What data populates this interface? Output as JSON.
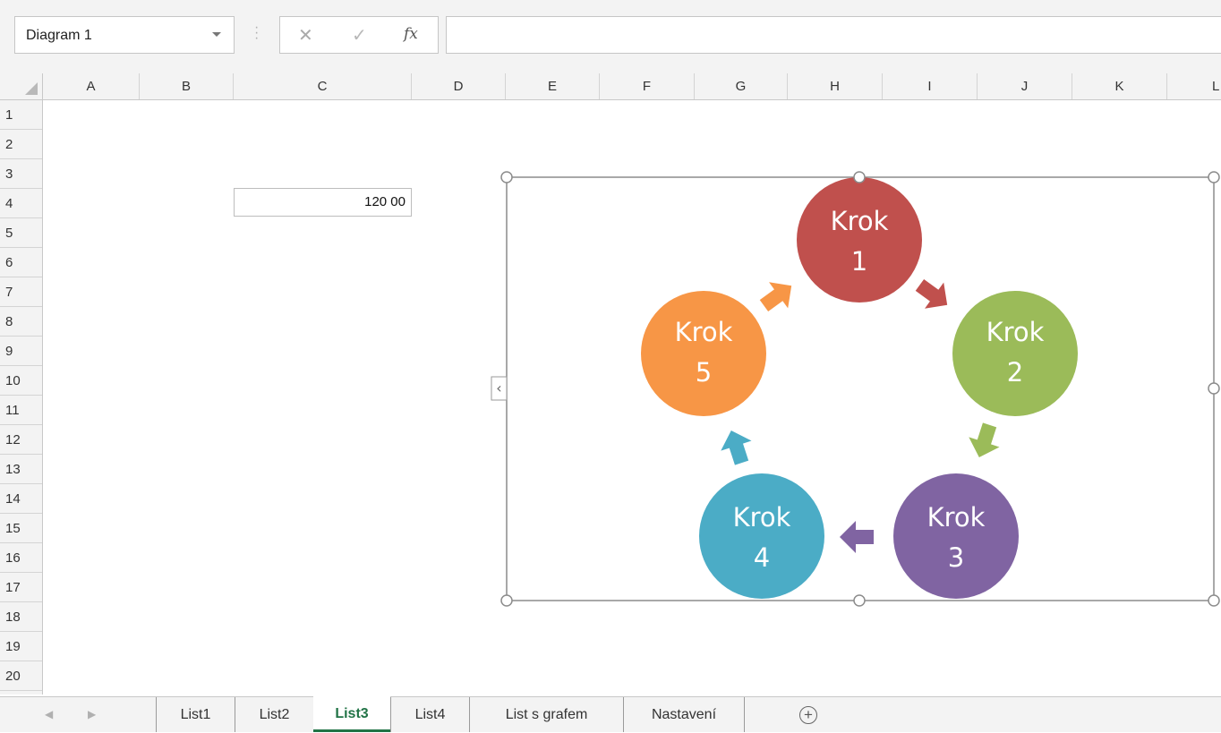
{
  "formula_bar": {
    "name_box": "Diagram 1",
    "cancel_icon": "✕",
    "enter_icon": "✓",
    "function_label": "fx",
    "formula": ""
  },
  "columns": [
    "A",
    "B",
    "C",
    "D",
    "E",
    "F",
    "G",
    "H",
    "I",
    "J",
    "K",
    "L"
  ],
  "rows": [
    "1",
    "2",
    "3",
    "4",
    "5",
    "6",
    "7",
    "8",
    "9",
    "10",
    "11",
    "12",
    "13",
    "14",
    "15",
    "16",
    "17",
    "18",
    "19",
    "20"
  ],
  "cells": {
    "C4": "120 00"
  },
  "smartart": {
    "name": "Diagram 1",
    "steps": [
      {
        "line1": "Krok",
        "line2": "1",
        "color": "#c0504d"
      },
      {
        "line1": "Krok",
        "line2": "2",
        "color": "#9bbb59"
      },
      {
        "line1": "Krok",
        "line2": "3",
        "color": "#8064a2"
      },
      {
        "line1": "Krok",
        "line2": "4",
        "color": "#4bacc6"
      },
      {
        "line1": "Krok",
        "line2": "5",
        "color": "#f79646"
      }
    ],
    "text_pane_toggle": "‹"
  },
  "sheet_tabs": {
    "tabs": [
      "List1",
      "List2",
      "List3",
      "List4",
      "List s grafem",
      "Nastavení"
    ],
    "active": "List3",
    "add_icon": "+"
  },
  "colors": {
    "accent_green": "#217346",
    "selection_border": "#8c8c8c"
  }
}
